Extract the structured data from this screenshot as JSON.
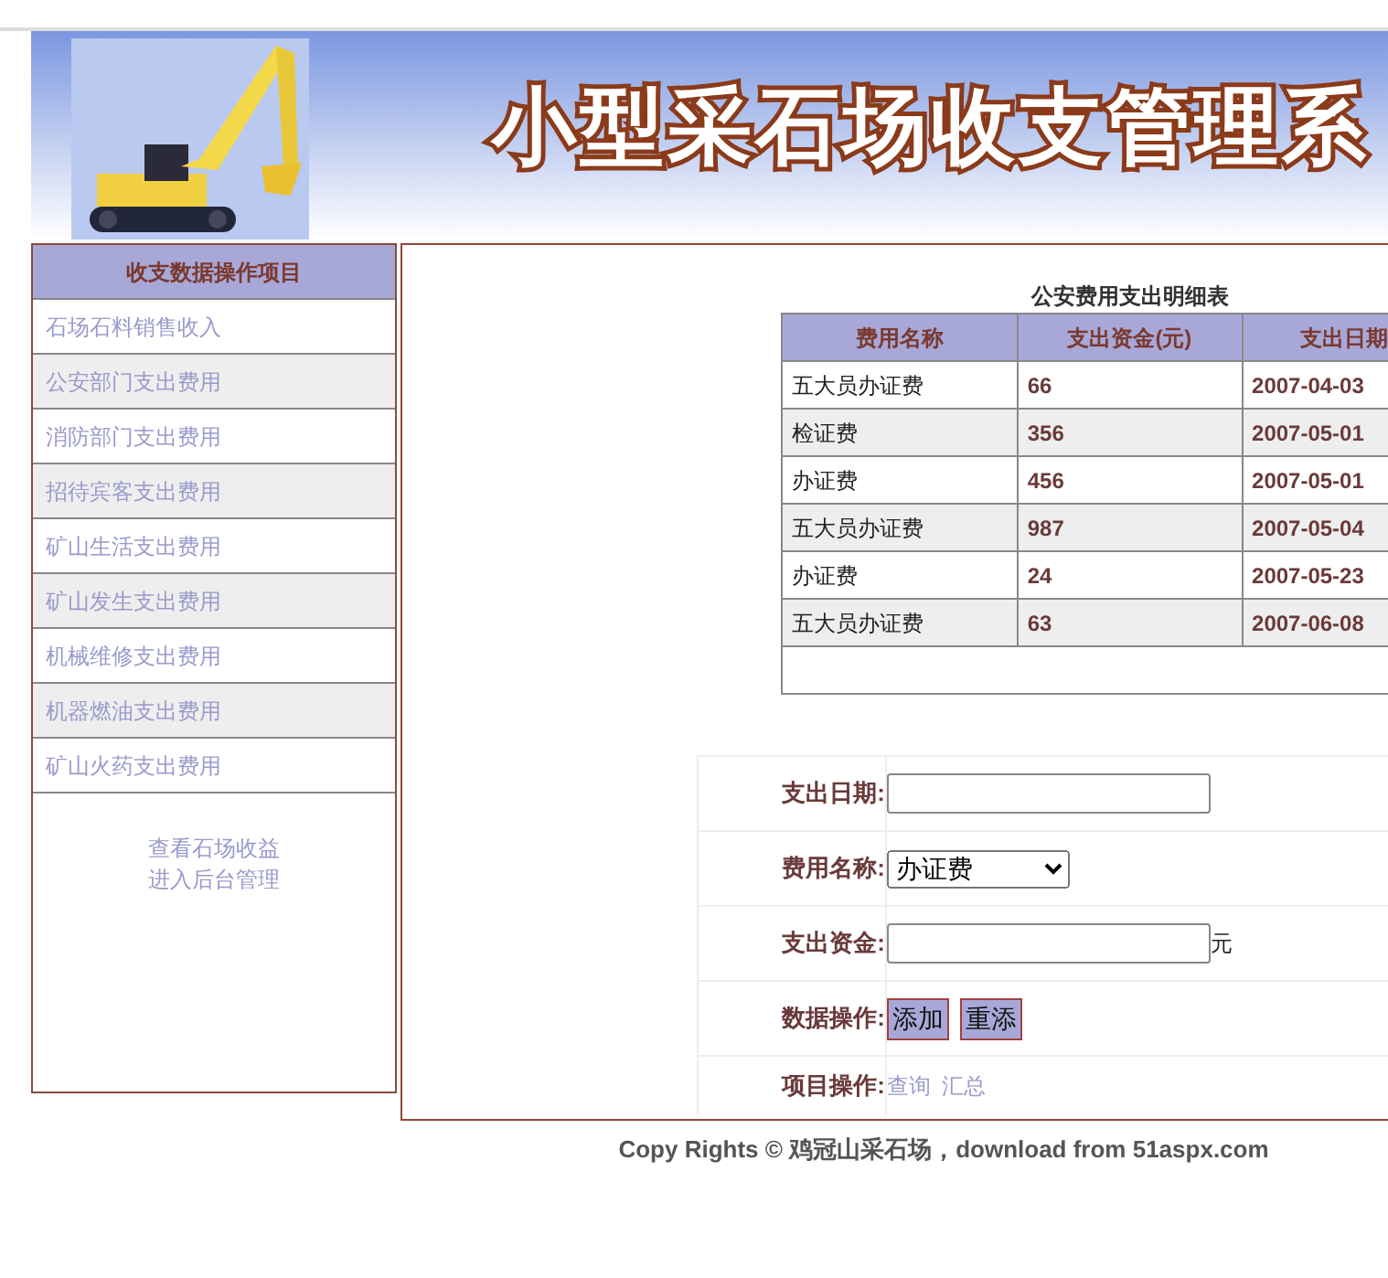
{
  "banner": {
    "title": "小型采石场收支管理系",
    "kind": "picture"
  },
  "sidebar": {
    "heading": "收支数据操作项目",
    "items": [
      {
        "label": "石场石料销售收入"
      },
      {
        "label": "公安部门支出费用"
      },
      {
        "label": "消防部门支出费用"
      },
      {
        "label": "招待宾客支出费用"
      },
      {
        "label": "矿山生活支出费用"
      },
      {
        "label": "矿山发生支出费用"
      },
      {
        "label": "机械维修支出费用"
      },
      {
        "label": "机器燃油支出费用"
      },
      {
        "label": "矿山火药支出费用"
      }
    ],
    "links": [
      "查看石场收益",
      "进入后台管理"
    ]
  },
  "table": {
    "caption": "公安费用支出明细表",
    "columns": [
      "费用名称",
      "支出资金(元)",
      "支出日期"
    ],
    "rows": [
      [
        "五大员办证费",
        "66",
        "2007-04-03"
      ],
      [
        "检证费",
        "356",
        "2007-05-01"
      ],
      [
        "办证费",
        "456",
        "2007-05-01"
      ],
      [
        "五大员办证费",
        "987",
        "2007-05-04"
      ],
      [
        "办证费",
        "24",
        "2007-05-23"
      ],
      [
        "五大员办证费",
        "63",
        "2007-06-08"
      ]
    ]
  },
  "form": [
    {
      "kind": "input",
      "label": "支出日期:"
    },
    {
      "kind": "select",
      "label": "费用名称:",
      "value": "办证费"
    },
    {
      "kind": "input",
      "label": "支出资金:",
      "unit": "元"
    },
    {
      "kind": "buttons",
      "label": "数据操作:",
      "buttons": [
        "添加",
        "重添"
      ]
    },
    {
      "kind": "links",
      "label": "项目操作:",
      "links": [
        "查询",
        "汇总"
      ]
    }
  ],
  "footer": {
    "text": "Copy Rights © 鸡冠山采石场，",
    "link": "download from 51aspx.com"
  }
}
